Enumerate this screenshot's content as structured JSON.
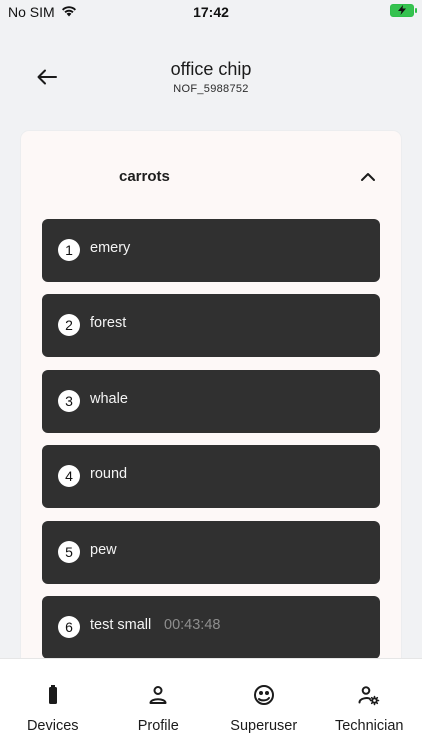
{
  "status_bar": {
    "carrier": "No SIM",
    "time": "17:42",
    "icons": [
      "wifi-icon",
      "battery-charging-icon"
    ]
  },
  "header": {
    "back_icon": "arrow-left-icon",
    "title": "office chip",
    "subtitle": "NOF_5988752"
  },
  "section": {
    "title": "carrots",
    "toggle_icon": "chevron-up-icon",
    "items": [
      {
        "number": "1",
        "label": "emery",
        "time": ""
      },
      {
        "number": "2",
        "label": "forest",
        "time": ""
      },
      {
        "number": "3",
        "label": "whale",
        "time": ""
      },
      {
        "number": "4",
        "label": "round",
        "time": ""
      },
      {
        "number": "5",
        "label": "pew",
        "time": ""
      },
      {
        "number": "6",
        "label": "test small",
        "time": "00:43:48"
      }
    ]
  },
  "bottom_nav": [
    {
      "label": "Devices",
      "icon": "battery-icon"
    },
    {
      "label": "Profile",
      "icon": "user-icon"
    },
    {
      "label": "Superuser",
      "icon": "superuser-icon"
    },
    {
      "label": "Technician",
      "icon": "user-gear-icon"
    }
  ],
  "colors": {
    "background": "#f1f2f4",
    "card": "#fdf8f7",
    "item": "#303030",
    "time_text": "#8e8e8e"
  }
}
